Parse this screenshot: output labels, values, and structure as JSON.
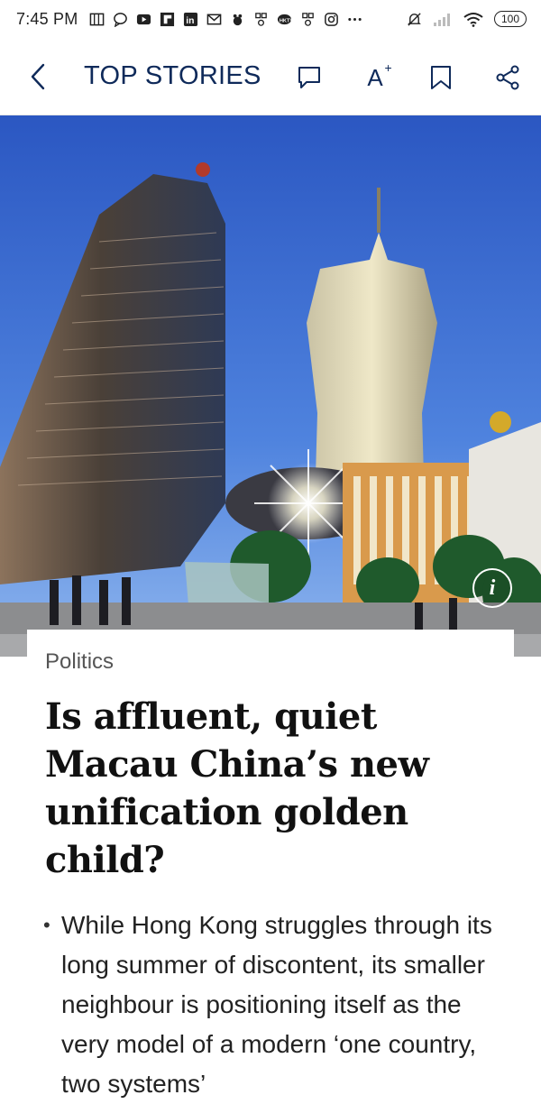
{
  "status_bar": {
    "time": "7:45 PM",
    "battery": "100",
    "icons": [
      "news-icon",
      "chat-icon",
      "youtube-icon",
      "flipboard-icon",
      "linkedin-icon",
      "gmail-icon",
      "bug-icon",
      "qr-icon",
      "hktv-icon",
      "qr-icon",
      "instagram-icon",
      "more-icon",
      "mute-icon",
      "signal-icon",
      "wifi-icon",
      "battery-icon"
    ]
  },
  "app_bar": {
    "title": "TOP STORIES",
    "font_glyph": "A",
    "font_plus": "+"
  },
  "hero": {
    "info_label": "i",
    "colors": {
      "sky": "#2f5fc9",
      "sky_light": "#6f9de8"
    }
  },
  "article": {
    "category": "Politics",
    "headline": "Is affluent, quiet Macau China’s new unification golden child?",
    "summary": [
      "While Hong Kong struggles through its long summer of discontent, its smaller neighbour is positioning itself as the very model of a modern ‘one country, two systems’"
    ]
  },
  "colors": {
    "accent": "#0f2a5a",
    "text": "#111111",
    "muted": "#555555"
  }
}
